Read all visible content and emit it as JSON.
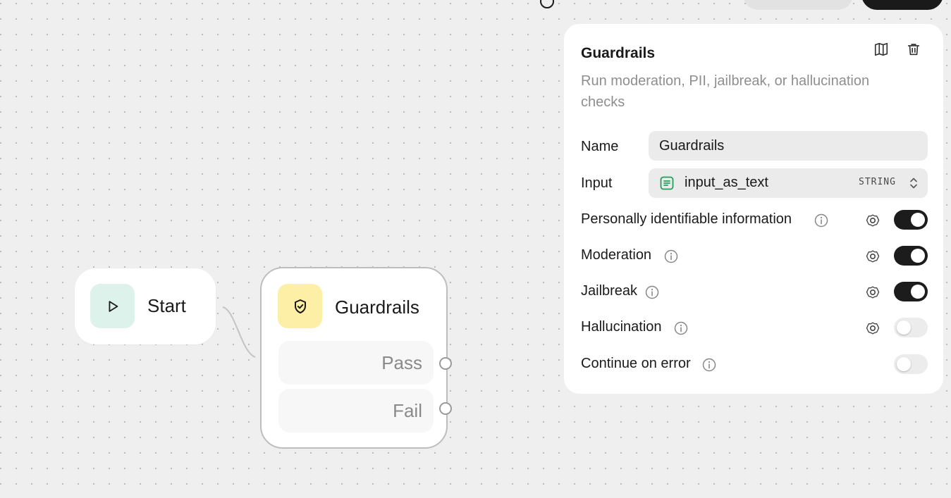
{
  "canvas": {
    "nodes": {
      "start": {
        "label": "Start",
        "icon": "play-icon",
        "icon_bg": "#dcf2ea"
      },
      "guardrails": {
        "label": "Guardrails",
        "icon": "shield-check-icon",
        "icon_bg": "#fdf0a6",
        "branches": [
          "Pass",
          "Fail"
        ]
      }
    }
  },
  "panel": {
    "title": "Guardrails",
    "description": "Run moderation, PII, jailbreak, or hallucination checks",
    "actions": [
      "docs-icon",
      "trash-icon"
    ],
    "name": {
      "label": "Name",
      "value": "Guardrails"
    },
    "input": {
      "label": "Input",
      "variable": "input_as_text",
      "type": "STRING",
      "icon": "text-variable-icon",
      "icon_color": "#22a05a"
    },
    "checks": [
      {
        "label": "Personally identifiable information",
        "enabled": true,
        "has_settings": true
      },
      {
        "label": "Moderation",
        "enabled": true,
        "has_settings": true
      },
      {
        "label": "Jailbreak",
        "enabled": true,
        "has_settings": true
      },
      {
        "label": "Hallucination",
        "enabled": false,
        "has_settings": true
      },
      {
        "label": "Continue on error",
        "enabled": false,
        "has_settings": false
      }
    ]
  },
  "colors": {
    "canvas_bg": "#efefef",
    "toggle_on": "#1c1c1c",
    "toggle_off": "#ececec"
  }
}
